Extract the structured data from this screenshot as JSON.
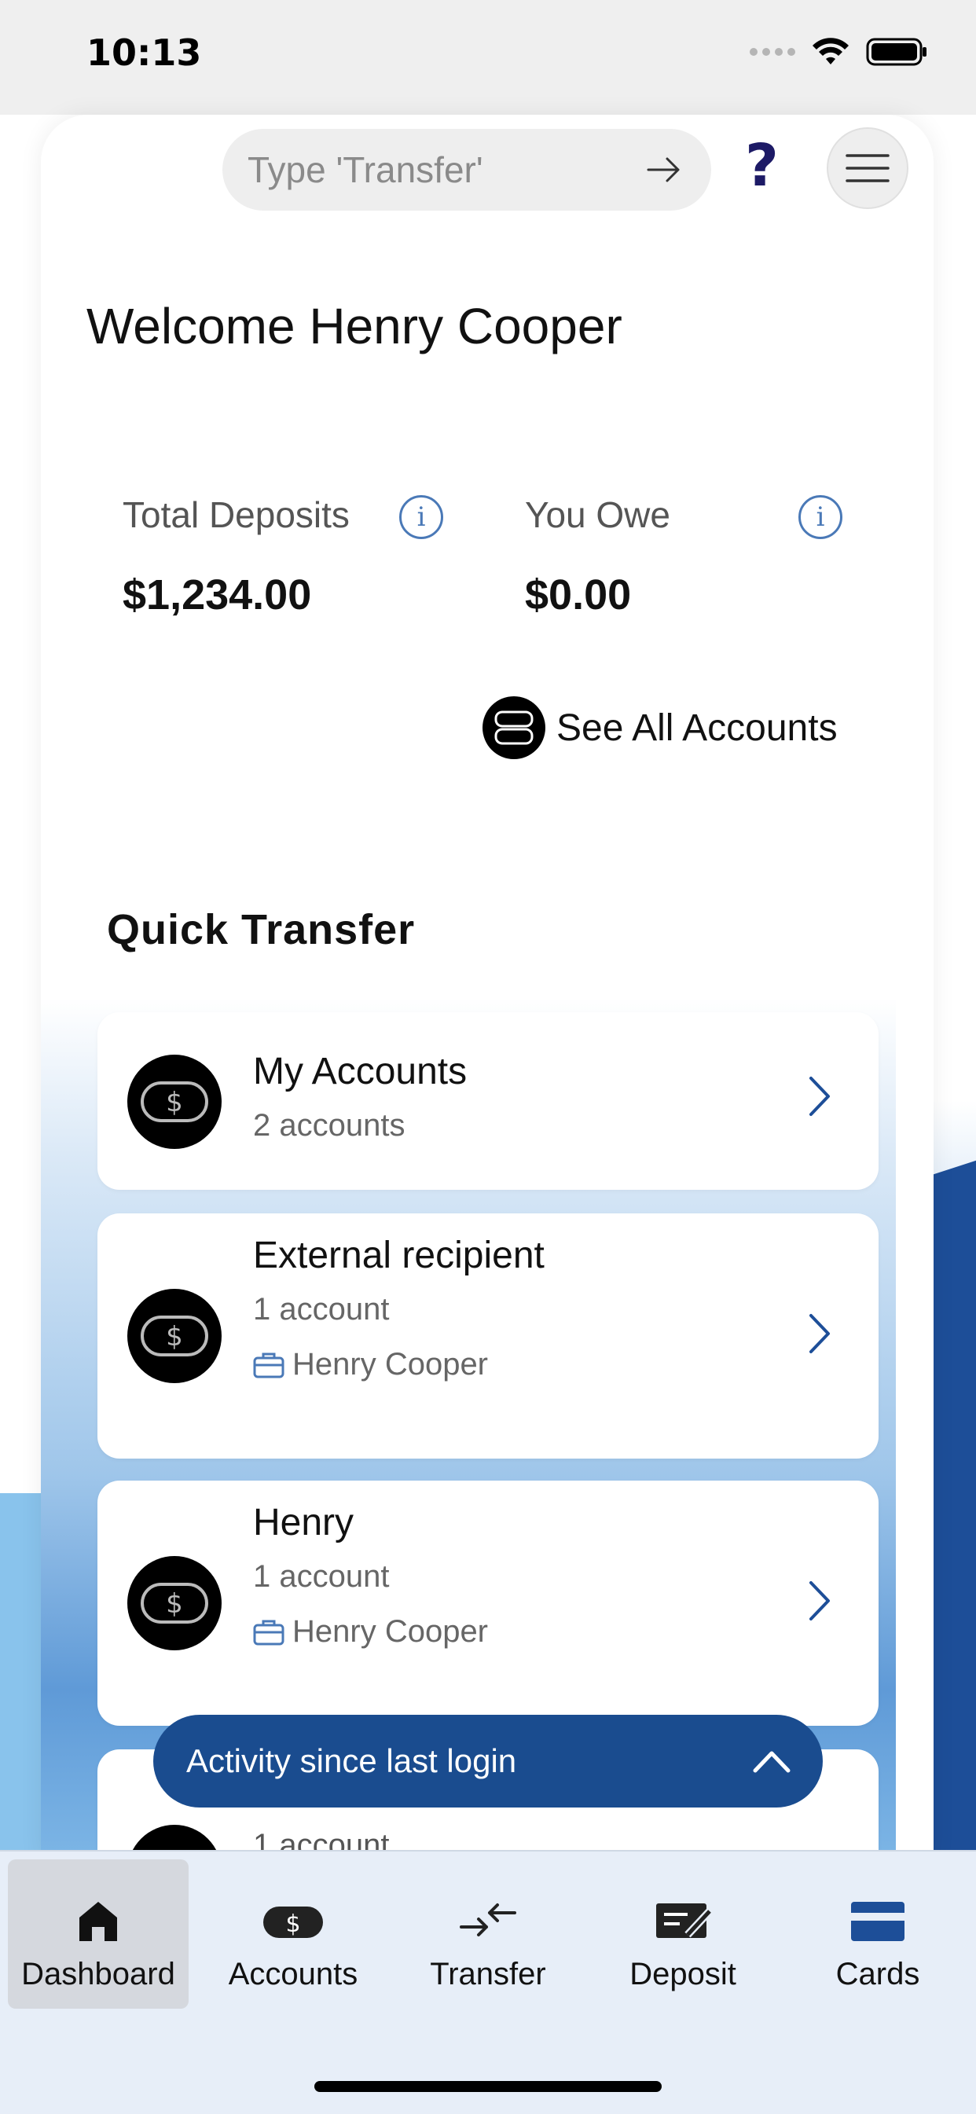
{
  "status_bar": {
    "time": "10:13"
  },
  "search": {
    "placeholder": "Type 'Transfer'"
  },
  "welcome": {
    "text": "Welcome Henry Cooper"
  },
  "stats": {
    "total_deposits_label": "Total Deposits",
    "total_deposits_value": "$1,234.00",
    "you_owe_label": "You Owe",
    "you_owe_value": "$0.00"
  },
  "see_all_label": "See All Accounts",
  "quick_transfer": {
    "title": "Quick Transfer",
    "items": [
      {
        "title": "My Accounts",
        "subtitle": "2 accounts"
      },
      {
        "title": "External recipient",
        "subtitle": "1 account",
        "owner": "Henry Cooper"
      },
      {
        "title": "Henry",
        "subtitle": "1 account",
        "owner": "Henry Cooper"
      },
      {
        "title": "",
        "subtitle": "1 account"
      }
    ]
  },
  "activity_bar": {
    "label": "Activity since last login"
  },
  "tabs": [
    {
      "label": "Dashboard",
      "icon": "home-icon",
      "active": true
    },
    {
      "label": "Accounts",
      "icon": "accounts-icon"
    },
    {
      "label": "Transfer",
      "icon": "transfer-icon"
    },
    {
      "label": "Deposit",
      "icon": "deposit-icon"
    },
    {
      "label": "Cards",
      "icon": "card-icon"
    }
  ],
  "colors": {
    "accent": "#1a4c8f",
    "help": "#1d1a66",
    "info": "#4a79b7"
  }
}
